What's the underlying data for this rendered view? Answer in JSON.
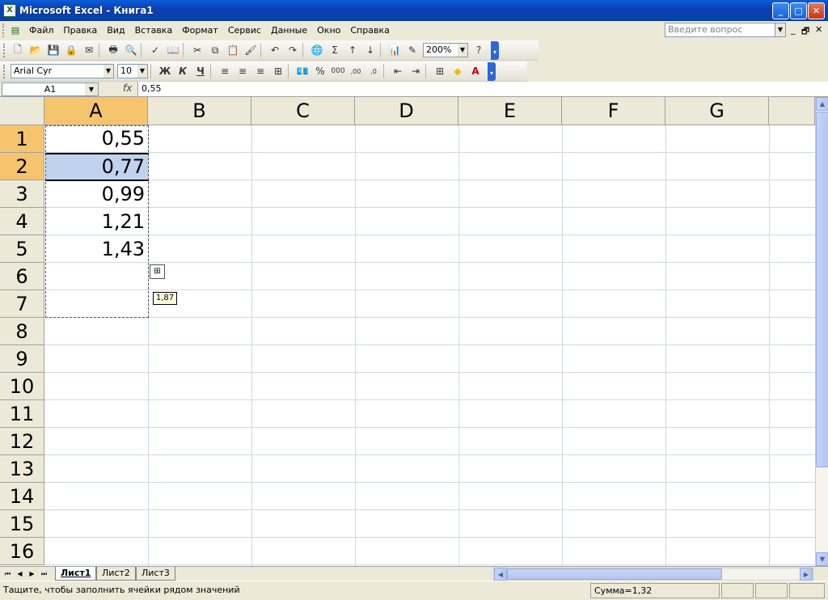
{
  "window": {
    "title": "Microsoft Excel - Книга1",
    "min": "_",
    "max": "□",
    "close": "✕"
  },
  "menu": {
    "items": [
      "Файл",
      "Правка",
      "Вид",
      "Вставка",
      "Формат",
      "Сервис",
      "Данные",
      "Окно",
      "Справка"
    ],
    "help_placeholder": "Введите вопрос",
    "doc_min": "_",
    "doc_restore": "🗗",
    "doc_close": "✕"
  },
  "toolbar_standard": {
    "zoom": "200%",
    "autosum": "Σ"
  },
  "toolbar_format": {
    "font": "Arial Cyr",
    "size": "10",
    "bold": "Ж",
    "italic": "К",
    "underline": "Ч",
    "percent": "%",
    "thousands": "000",
    "inc_decimal": ",00",
    "dec_decimal": ",0"
  },
  "formula_bar": {
    "cell": "A1",
    "fx": "fx",
    "value": "0,55"
  },
  "columns": [
    "A",
    "B",
    "C",
    "D",
    "E",
    "F",
    "G"
  ],
  "rows": [
    "1",
    "2",
    "3",
    "4",
    "5",
    "6",
    "7",
    "8",
    "9",
    "10",
    "11",
    "12",
    "13",
    "14",
    "15",
    "16"
  ],
  "cells": {
    "A1": "0,55",
    "A2": "0,77",
    "A3": "0,99",
    "A4": "1,21",
    "A5": "1,43"
  },
  "fill_tooltip": "1,87",
  "sheets": [
    "Лист1",
    "Лист2",
    "Лист3"
  ],
  "status": {
    "message": "Тащите, чтобы заполнить ячейки рядом значений",
    "sum": "Сумма=1,32"
  }
}
